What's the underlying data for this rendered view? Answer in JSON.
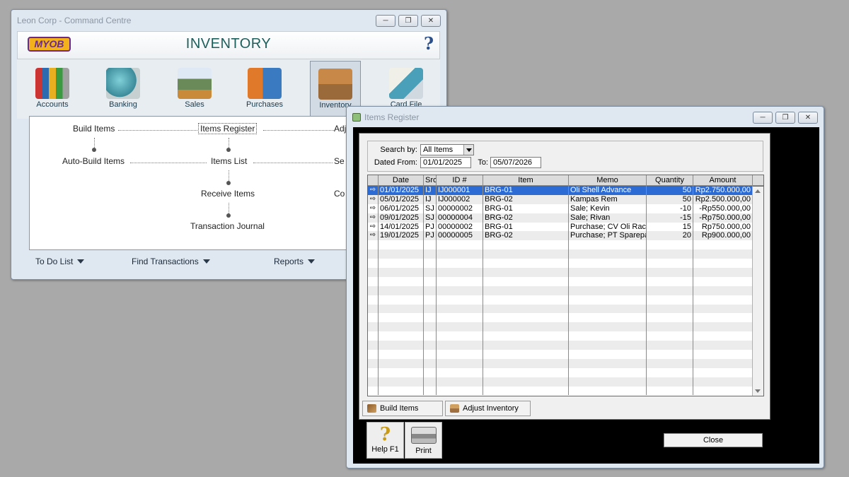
{
  "command_centre": {
    "title": "Leon Corp - Command Centre",
    "logo": "MYOB",
    "banner_title": "INVENTORY",
    "help_glyph": "?",
    "modules": [
      {
        "label": "Accounts",
        "icon": "accounts-icon"
      },
      {
        "label": "Banking",
        "icon": "banking-icon"
      },
      {
        "label": "Sales",
        "icon": "sales-icon"
      },
      {
        "label": "Purchases",
        "icon": "purchases-icon"
      },
      {
        "label": "Inventory",
        "icon": "inventory-icon",
        "active": true
      },
      {
        "label": "Card File",
        "icon": "card-file-icon"
      }
    ],
    "flow": {
      "build_items": "Build Items",
      "items_register": "Items Register",
      "adjust_partial": "Adj",
      "auto_build_items": "Auto-Build Items",
      "items_list": "Items List",
      "set_partial": "Se",
      "receive_items": "Receive Items",
      "count_partial": "Co",
      "transaction_journal": "Transaction Journal"
    },
    "bottom_menu": {
      "todo": "To Do List",
      "find": "Find Transactions",
      "reports": "Reports"
    }
  },
  "items_register": {
    "title": "Items Register",
    "filters": {
      "search_by_label": "Search by:",
      "search_by_value": "All Items",
      "dated_from_label": "Dated From:",
      "dated_from_value": "01/01/2025",
      "to_label": "To:",
      "to_value": "05/07/2026"
    },
    "columns": [
      "",
      "Date",
      "Src",
      "ID #",
      "Item",
      "Memo",
      "Quantity",
      "Amount"
    ],
    "rows": [
      {
        "date": "01/01/2025",
        "src": "IJ",
        "id": "IJ000001",
        "item": "BRG-01",
        "memo": "Oli Shell Advance",
        "qty": "50",
        "amount": "Rp2.750.000,00",
        "selected": true
      },
      {
        "date": "05/01/2025",
        "src": "IJ",
        "id": "IJ000002",
        "item": "BRG-02",
        "memo": "Kampas Rem",
        "qty": "50",
        "amount": "Rp2.500.000,00"
      },
      {
        "date": "06/01/2025",
        "src": "SJ",
        "id": "00000002",
        "item": "BRG-01",
        "memo": "Sale; Kevin",
        "qty": "-10",
        "amount": "-Rp550.000,00"
      },
      {
        "date": "09/01/2025",
        "src": "SJ",
        "id": "00000004",
        "item": "BRG-02",
        "memo": "Sale; Rivan",
        "qty": "-15",
        "amount": "-Rp750.000,00"
      },
      {
        "date": "14/01/2025",
        "src": "PJ",
        "id": "00000002",
        "item": "BRG-01",
        "memo": "Purchase; CV Oli Racing",
        "qty": "15",
        "amount": "Rp750.000,00"
      },
      {
        "date": "19/01/2025",
        "src": "PJ",
        "id": "00000005",
        "item": "BRG-02",
        "memo": "Purchase; PT Sparepart",
        "qty": "20",
        "amount": "Rp900.000,00"
      }
    ],
    "buttons": {
      "build_items": "Build Items",
      "adjust_inventory": "Adjust Inventory",
      "help": "Help F1",
      "print": "Print",
      "close": "Close"
    }
  },
  "colors": {
    "desktop": "#a9a9a9",
    "selection": "#2c6ad4",
    "banner_title": "#1c5f5b"
  }
}
